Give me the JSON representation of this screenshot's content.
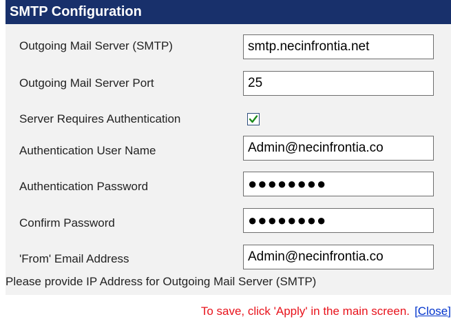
{
  "panel": {
    "title": "SMTP Configuration"
  },
  "fields": {
    "smtp_server": {
      "label": "Outgoing Mail Server (SMTP)",
      "value": "smtp.necinfrontia.net"
    },
    "smtp_port": {
      "label": "Outgoing Mail Server Port",
      "value": "25"
    },
    "requires_auth": {
      "label": "Server Requires Authentication",
      "checked": true
    },
    "auth_user": {
      "label": "Authentication User Name",
      "value": "Admin@necinfrontia.co"
    },
    "auth_password": {
      "label": "Authentication Password",
      "value": "●●●●●●●●"
    },
    "confirm_password": {
      "label": "Confirm Password",
      "value": "●●●●●●●●"
    },
    "from_email": {
      "label": "'From' Email Address",
      "value": "Admin@necinfrontia.co"
    }
  },
  "hint_text": "Please provide IP Address for Outgoing Mail Server (SMTP)",
  "footer": {
    "save_note": "To save, click 'Apply' in the main screen.",
    "close_label": "[Close]"
  },
  "colors": {
    "title_bg": "#18306b",
    "body_bg": "#f2f2f2",
    "note_red": "#e8121b",
    "link_blue": "#0033cc",
    "check_green": "#1a8a1a"
  }
}
